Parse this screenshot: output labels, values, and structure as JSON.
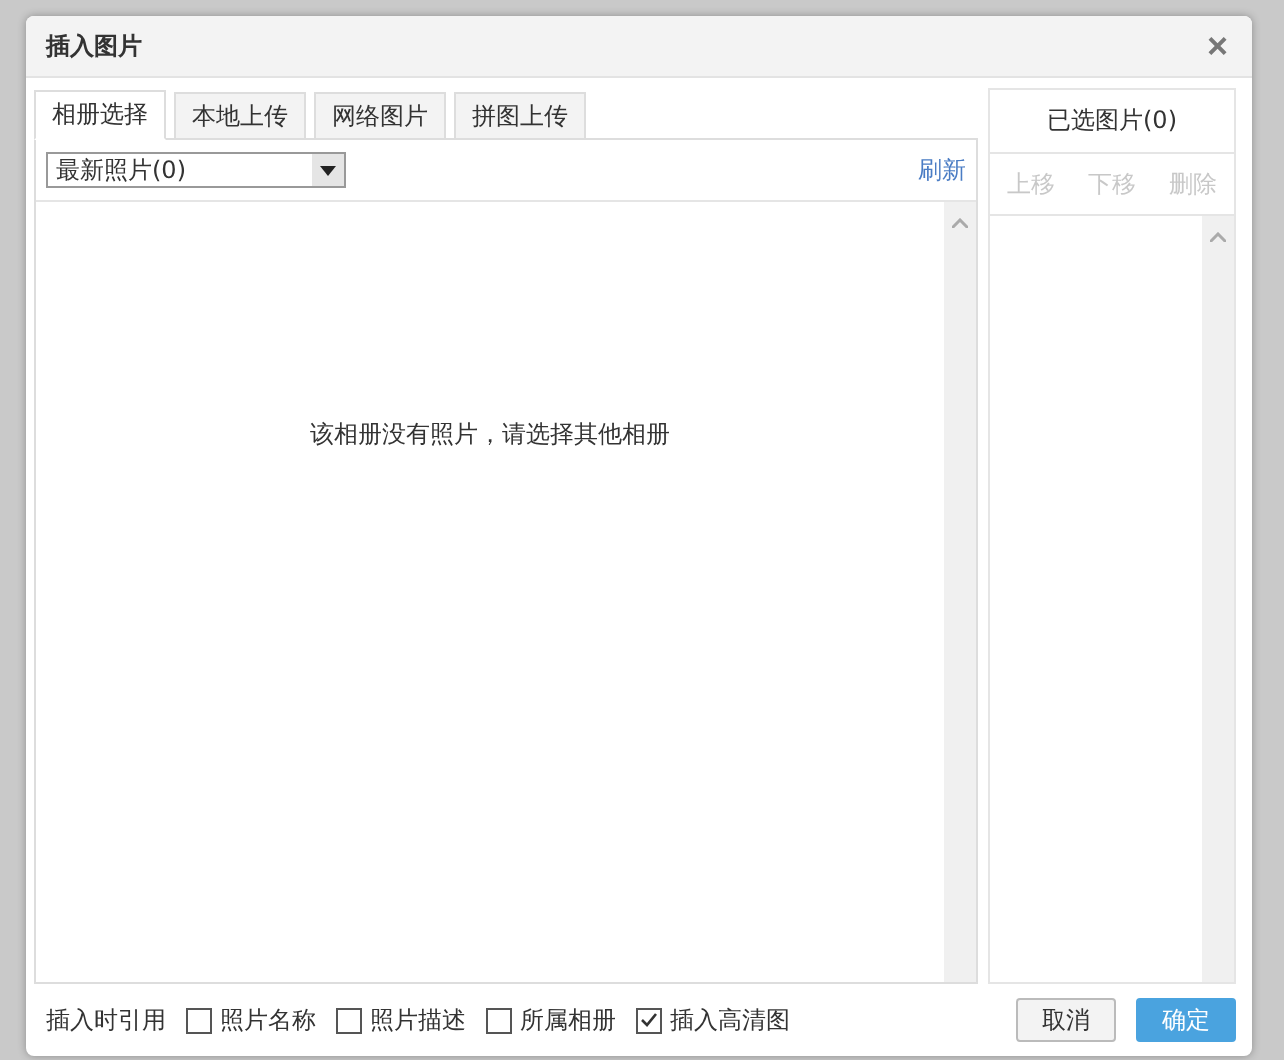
{
  "window": {
    "title": "插入图片",
    "close": "×"
  },
  "tabs": [
    {
      "label": "相册选择",
      "selected": true
    },
    {
      "label": "本地上传",
      "selected": false
    },
    {
      "label": "网络图片",
      "selected": false
    },
    {
      "label": "拼图上传",
      "selected": false
    }
  ],
  "album_select": {
    "value": "最新照片(0)"
  },
  "refresh": "刷新",
  "empty_message": "该相册没有照片，请选择其他相册",
  "selected_panel": {
    "title": "已选图片(0)",
    "actions": [
      {
        "label": "上移",
        "disabled": true
      },
      {
        "label": "下移",
        "disabled": true
      },
      {
        "label": "删除",
        "disabled": true
      }
    ]
  },
  "footer": {
    "label": "插入时引用",
    "options": [
      {
        "label": "照片名称",
        "checked": false
      },
      {
        "label": "照片描述",
        "checked": false
      },
      {
        "label": "所属相册",
        "checked": false
      },
      {
        "label": "插入高清图",
        "checked": true
      }
    ],
    "buttons": [
      {
        "label": "取消",
        "kind": "secondary"
      },
      {
        "label": "确定",
        "kind": "primary"
      }
    ]
  }
}
